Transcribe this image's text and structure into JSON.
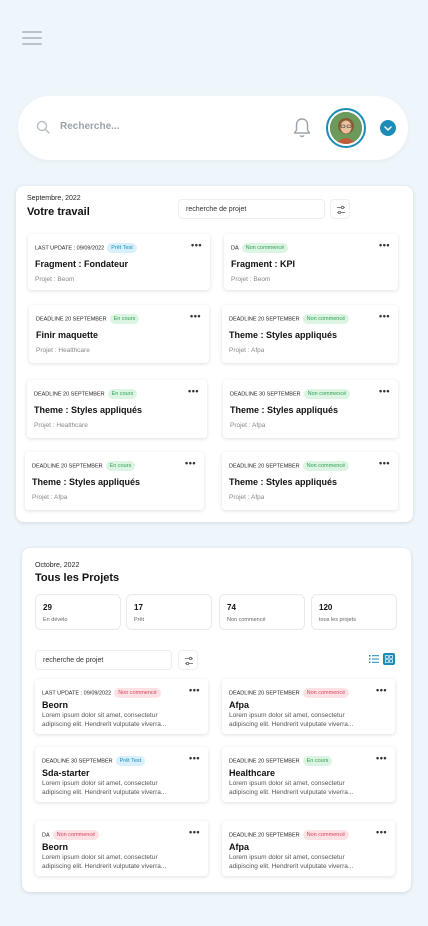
{
  "header": {
    "search_placeholder": "Recherche..."
  },
  "colors": {
    "accent": "#1b8cb8",
    "background": "#eef6fb"
  },
  "work": {
    "date": "Septembre, 2022",
    "title": "Votre travail",
    "search_placeholder": "recherche de projet",
    "cards": [
      {
        "meta": "LAST UPDATE : 09/09/2022",
        "status": "Prêt Test",
        "title": "Fragment : Fondateur",
        "project": "Projet : Beom"
      },
      {
        "meta": "DA",
        "status": "Non commencé",
        "title": "Fragment : KPI",
        "project": "Projet : Beom"
      },
      {
        "meta": "DEADLINE 20 SEPTEMBER",
        "status": "En cours",
        "title": "Finir maquette",
        "project": "Projet : Healthcare"
      },
      {
        "meta": "DEADLINE 20 SEPTEMBER",
        "status": "Non commencé",
        "title": "Theme : Styles appliqués",
        "project": "Projet : Afpa"
      },
      {
        "meta": "DEADLINE 20 SEPTEMBER",
        "status": "En cours",
        "title": "Theme : Styles appliqués",
        "project": "Projet : Healthcare"
      },
      {
        "meta": "DEADLINE 30 SEPTEMBER",
        "status": "Non commencé",
        "title": "Theme : Styles appliqués",
        "project": "Projet : Afpa"
      },
      {
        "meta": "DEADLINE 20 SEPTEMBER",
        "status": "En cours",
        "title": "Theme : Styles appliqués",
        "project": "Projet : Afpa"
      },
      {
        "meta": "DEADLINE 20 SEPTEMBER",
        "status": "Non commencé",
        "title": "Theme : Styles appliqués",
        "project": "Projet : Afpa"
      }
    ]
  },
  "projects": {
    "date": "Octobre, 2022",
    "title": "Tous les Projets",
    "stats": [
      {
        "value": "29",
        "label": "En dévelo"
      },
      {
        "value": "17",
        "label": "Prêt"
      },
      {
        "value": "74",
        "label": "Non commencé"
      },
      {
        "value": "120",
        "label": "tous les projets"
      }
    ],
    "search_placeholder": "recherche de projet",
    "cards": [
      {
        "meta": "LAST UPDATE : 09/09/2022",
        "status": "Non commencé",
        "title": "Beorn",
        "desc": "Lorem ipsum dolor sit amet, consectetur adipiscing elit. Hendrerit vulputate viverra..."
      },
      {
        "meta": "DEADLINE 20 SEPTEMBER",
        "status": "Non commencé",
        "title": "Afpa",
        "desc": "Lorem ipsum dolor sit amet, consectetur adipiscing elit. Hendrerit vulputate viverra..."
      },
      {
        "meta": "DEADLINE 30 SEPTEMBER",
        "status": "Prêt Test",
        "title": "Sda-starter",
        "desc": "Lorem ipsum dolor sit amet, consectetur adipiscing elit. Hendrerit vulputate viverra..."
      },
      {
        "meta": "DEADLINE 20 SEPTEMBER",
        "status": "En cours",
        "title": "Healthcare",
        "desc": "Lorem ipsum dolor sit amet, consectetur adipiscing elit. Hendrerit vulputate viverra..."
      },
      {
        "meta": "DA",
        "status": "Non commencé",
        "title": "Beorn",
        "desc": "Lorem ipsum dolor sit amet, consectetur adipiscing elit. Hendrerit vulputate viverra..."
      },
      {
        "meta": "DEADLINE 20 SEPTEMBER",
        "status": "Non commencé",
        "title": "Afpa",
        "desc": "Lorem ipsum dolor sit amet, consectetur adipiscing elit. Hendrerit vulputate viverra..."
      }
    ]
  }
}
